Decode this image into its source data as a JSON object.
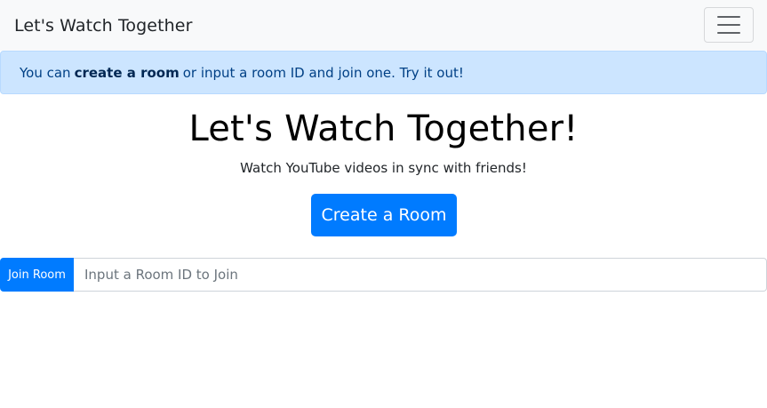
{
  "navbar": {
    "brand": "Let's Watch Together",
    "toggler_icon": "hamburger-menu-icon"
  },
  "alert": {
    "prefix": "You can",
    "link": "create a room",
    "suffix": "or input a room ID and join one. Try it out!"
  },
  "hero": {
    "title": "Let's Watch Together!",
    "subtitle": "Watch YouTube videos in sync with friends!",
    "create_button": "Create a Room"
  },
  "join": {
    "button": "Join Room",
    "placeholder": "Input a Room ID to Join",
    "value": ""
  },
  "colors": {
    "primary": "#007bff",
    "navbar_bg": "#f8f9fa",
    "alert_bg": "#cce5ff",
    "alert_text": "#004085"
  }
}
